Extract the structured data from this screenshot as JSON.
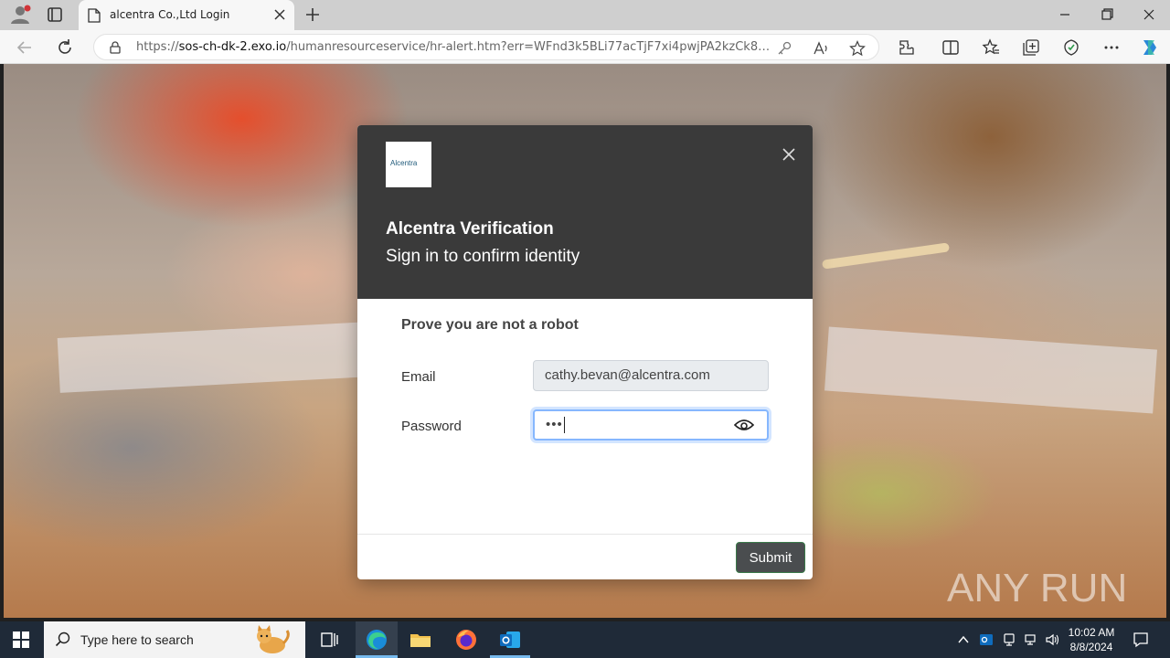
{
  "browser": {
    "tab": {
      "title": "alcentra Co.,Ltd Login"
    },
    "address": {
      "host": "sos-ch-dk-2.exo.io",
      "scheme": "https://",
      "path": "/humanresourceservice/hr-alert.htm?err=WFnd3k5BLi77acTjF7xi4pwjPA2kzCk84IAFH..."
    }
  },
  "modal": {
    "logo_text": "Alcentra",
    "title": "Alcentra Verification",
    "subtitle": "Sign in to confirm identity",
    "body_title": "Prove you are not a robot",
    "email_label": "Email",
    "email_value": "cathy.bevan@alcentra.com",
    "password_label": "Password",
    "password_mask": "•••",
    "submit_label": "Submit"
  },
  "watermark": {
    "text": "ANY RUN"
  },
  "taskbar": {
    "search_placeholder": "Type here to search",
    "time": "10:02 AM",
    "date": "8/8/2024"
  },
  "colors": {
    "modal_header": "#3a3a3a",
    "focus_ring": "#86b7fe",
    "submit_bg": "#4a4d4f",
    "taskbar": "#1f2a38"
  }
}
